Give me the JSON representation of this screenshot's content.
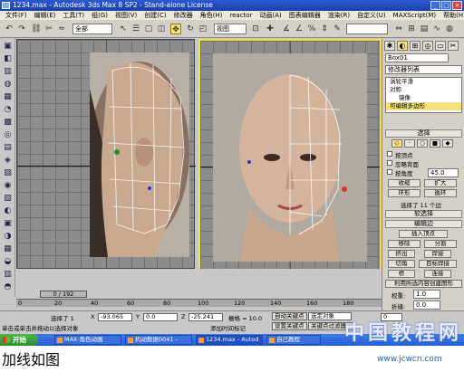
{
  "window": {
    "title": "1234.max - Autodesk 3ds Max 8 SP2 - Stand-alone License",
    "controls": [
      "_",
      "□",
      "×"
    ]
  },
  "menu": [
    "文件(F)",
    "编辑(E)",
    "工具(T)",
    "组(G)",
    "视图(V)",
    "创建(C)",
    "修改器",
    "角色(H)",
    "reactor",
    "动画(A)",
    "图表编辑器",
    "渲染(R)",
    "自定义(U)",
    "MAXScript(M)",
    "帮助(H)"
  ],
  "toolbar": {
    "selection_filter": "全部",
    "ref_coord": "视图"
  },
  "viewports": {
    "left_label": "",
    "right_label": ""
  },
  "command_panel": {
    "object_name": "Box01",
    "modifier_list": "修改器列表",
    "stack": [
      "涡轮平滑",
      "对称",
      "镜像",
      "可编辑多边形"
    ],
    "selection_rollout": "选择",
    "by_vertex": "按顶点",
    "ignore_backface": "忽略背面",
    "by_angle": "按角度",
    "angle_value": "45.0",
    "shrink": "收缩",
    "grow": "扩大",
    "ring": "环形",
    "loop": "循环",
    "selected_info": "选择了 11 个边",
    "soft_selection": "软选择",
    "edit_edges": "编辑边",
    "insert_vertex": "插入顶点",
    "remove": "移除",
    "split": "分割",
    "extrude": "挤出",
    "weld": "焊接",
    "chamfer": "切角",
    "target_weld": "目标焊接",
    "bridge": "桥",
    "connect": "连接",
    "create_shape": "利用所选内容创建图形",
    "weight_label": "权重:",
    "weight_value": "1.0",
    "crease_label": "折缝:",
    "crease_value": "0.0"
  },
  "timeline": {
    "frame_slider": "0 / 192",
    "ticks": [
      "0",
      "20",
      "40",
      "60",
      "80",
      "100",
      "120",
      "140",
      "160",
      "180"
    ]
  },
  "status": {
    "selected": "选择了 1",
    "x_label": "X",
    "x_value": "-93.065",
    "y_label": "Y",
    "y_value": "0.0",
    "z_label": "Z",
    "z_value": "-25.241",
    "grid": "栅格 = 10.0",
    "auto_key": "自动关键点",
    "set_key": "设置关键点",
    "selected_obj": "选定对象",
    "key_filters": "关键点过滤器...",
    "prompt1": "单击或单击并拖动以选择对象",
    "prompt2": "添加时间标记",
    "frame_value": "0"
  },
  "taskbar": {
    "start": "开始",
    "tasks": [
      "MAX·角色动画",
      "机动数据0041 -",
      "1234.max - Autod",
      "自己教程"
    ]
  },
  "caption": "加线如图",
  "watermark": "中国教程网",
  "watermark_url": "www.jcwcn.com"
}
